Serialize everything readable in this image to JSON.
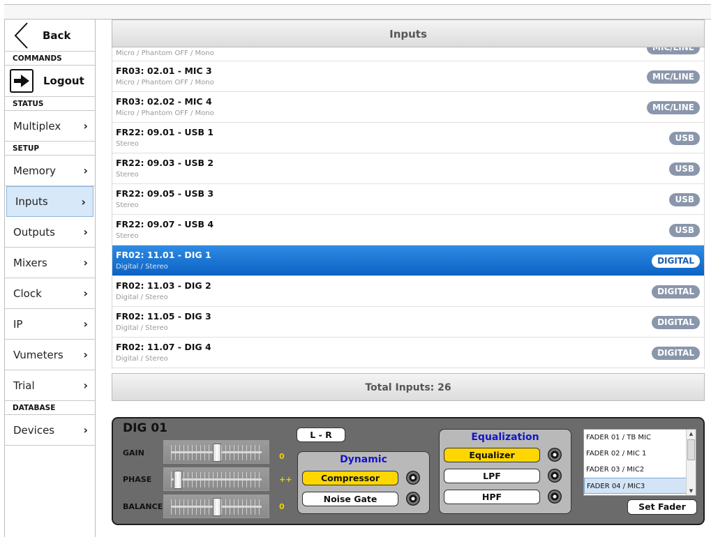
{
  "sidebar": {
    "back_label": "Back",
    "sections": {
      "commands": "COMMANDS",
      "status": "STATUS",
      "setup": "SETUP",
      "database": "DATABASE"
    },
    "logout_label": "Logout",
    "items": {
      "multiplex": "Multiplex",
      "memory": "Memory",
      "inputs": "Inputs",
      "outputs": "Outputs",
      "mixers": "Mixers",
      "clock": "Clock",
      "ip": "IP",
      "vumeters": "Vumeters",
      "trial": "Trial",
      "devices": "Devices"
    },
    "active_item": "Inputs"
  },
  "main": {
    "header": "Inputs",
    "footer": "Total Inputs: 26",
    "rows": [
      {
        "title": "",
        "sub": "Micro / Phantom OFF / Mono",
        "badge": "MIC/LINE",
        "partial": true
      },
      {
        "title": "FR03: 02.01  -  MIC 3",
        "sub": "Micro / Phantom OFF / Mono",
        "badge": "MIC/LINE"
      },
      {
        "title": "FR03: 02.02  -  MIC 4",
        "sub": "Micro / Phantom OFF / Mono",
        "badge": "MIC/LINE"
      },
      {
        "title": "FR22: 09.01  -  USB 1",
        "sub": "Stereo",
        "badge": "USB"
      },
      {
        "title": "FR22: 09.03  -  USB 2",
        "sub": "Stereo",
        "badge": "USB"
      },
      {
        "title": "FR22: 09.05  -  USB 3",
        "sub": "Stereo",
        "badge": "USB"
      },
      {
        "title": "FR22: 09.07  -  USB 4",
        "sub": "Stereo",
        "badge": "USB"
      },
      {
        "title": "FR02: 11.01  -  DIG 1",
        "sub": "Digital / Stereo",
        "badge": "DIGITAL",
        "selected": true
      },
      {
        "title": "FR02: 11.03  -  DIG 2",
        "sub": "Digital / Stereo",
        "badge": "DIGITAL"
      },
      {
        "title": "FR02: 11.05  -  DIG 3",
        "sub": "Digital / Stereo",
        "badge": "DIGITAL"
      },
      {
        "title": "FR02: 11.07  -  DIG 4",
        "sub": "Digital / Stereo",
        "badge": "DIGITAL"
      }
    ]
  },
  "panel": {
    "title": "DIG 01",
    "gain_label": "GAIN",
    "gain_value": "0",
    "phase_label": "PHASE",
    "phase_value": "++",
    "balance_label": "BALANCE",
    "balance_value": "0",
    "lr_button": "L - R",
    "dynamic_title": "Dynamic",
    "compressor_label": "Compressor",
    "noise_gate_label": "Noise Gate",
    "equalization_title": "Equalization",
    "equalizer_label": "Equalizer",
    "lpf_label": "LPF",
    "hpf_label": "HPF",
    "fader_options": [
      "FADER 01 / TB MIC",
      "FADER 02 / MIC 1",
      "FADER 03 / MIC2",
      "FADER 04 / MIC3"
    ],
    "fader_selected": "FADER 04 / MIC3",
    "set_fader_label": "Set Fader"
  },
  "colors": {
    "selected_row": "#0b62c4",
    "badge": "#8a96ab",
    "toggle_on": "#ffd700",
    "group_title": "#1414c8",
    "slider_value": "#f0d000"
  }
}
